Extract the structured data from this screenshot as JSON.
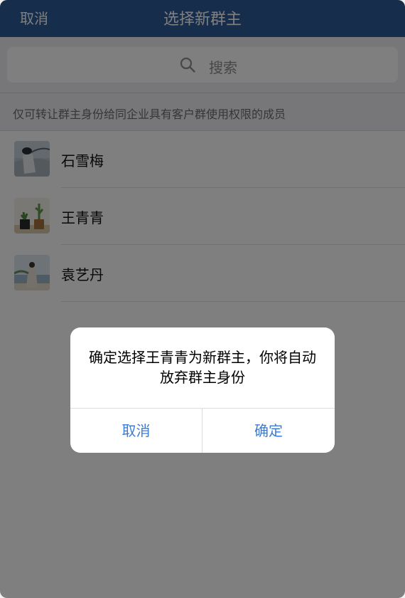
{
  "navbar": {
    "cancel_label": "取消",
    "title": "选择新群主",
    "bg_color": "#2f5b99"
  },
  "search": {
    "placeholder": "搜索",
    "icon": "search-icon"
  },
  "hint": {
    "text": "仅可转让群主身份给同企业具有客户群使用权限的成员"
  },
  "members": [
    {
      "name": "石雪梅",
      "avatar": "avatar-person-beach"
    },
    {
      "name": "王青青",
      "avatar": "avatar-plants"
    },
    {
      "name": "袁艺丹",
      "avatar": "avatar-person-sea"
    }
  ],
  "dialog": {
    "message": "确定选择王青青为新群主，你将自动放弃群主身份",
    "cancel_label": "取消",
    "confirm_label": "确定",
    "button_color": "#3a7bd5"
  }
}
